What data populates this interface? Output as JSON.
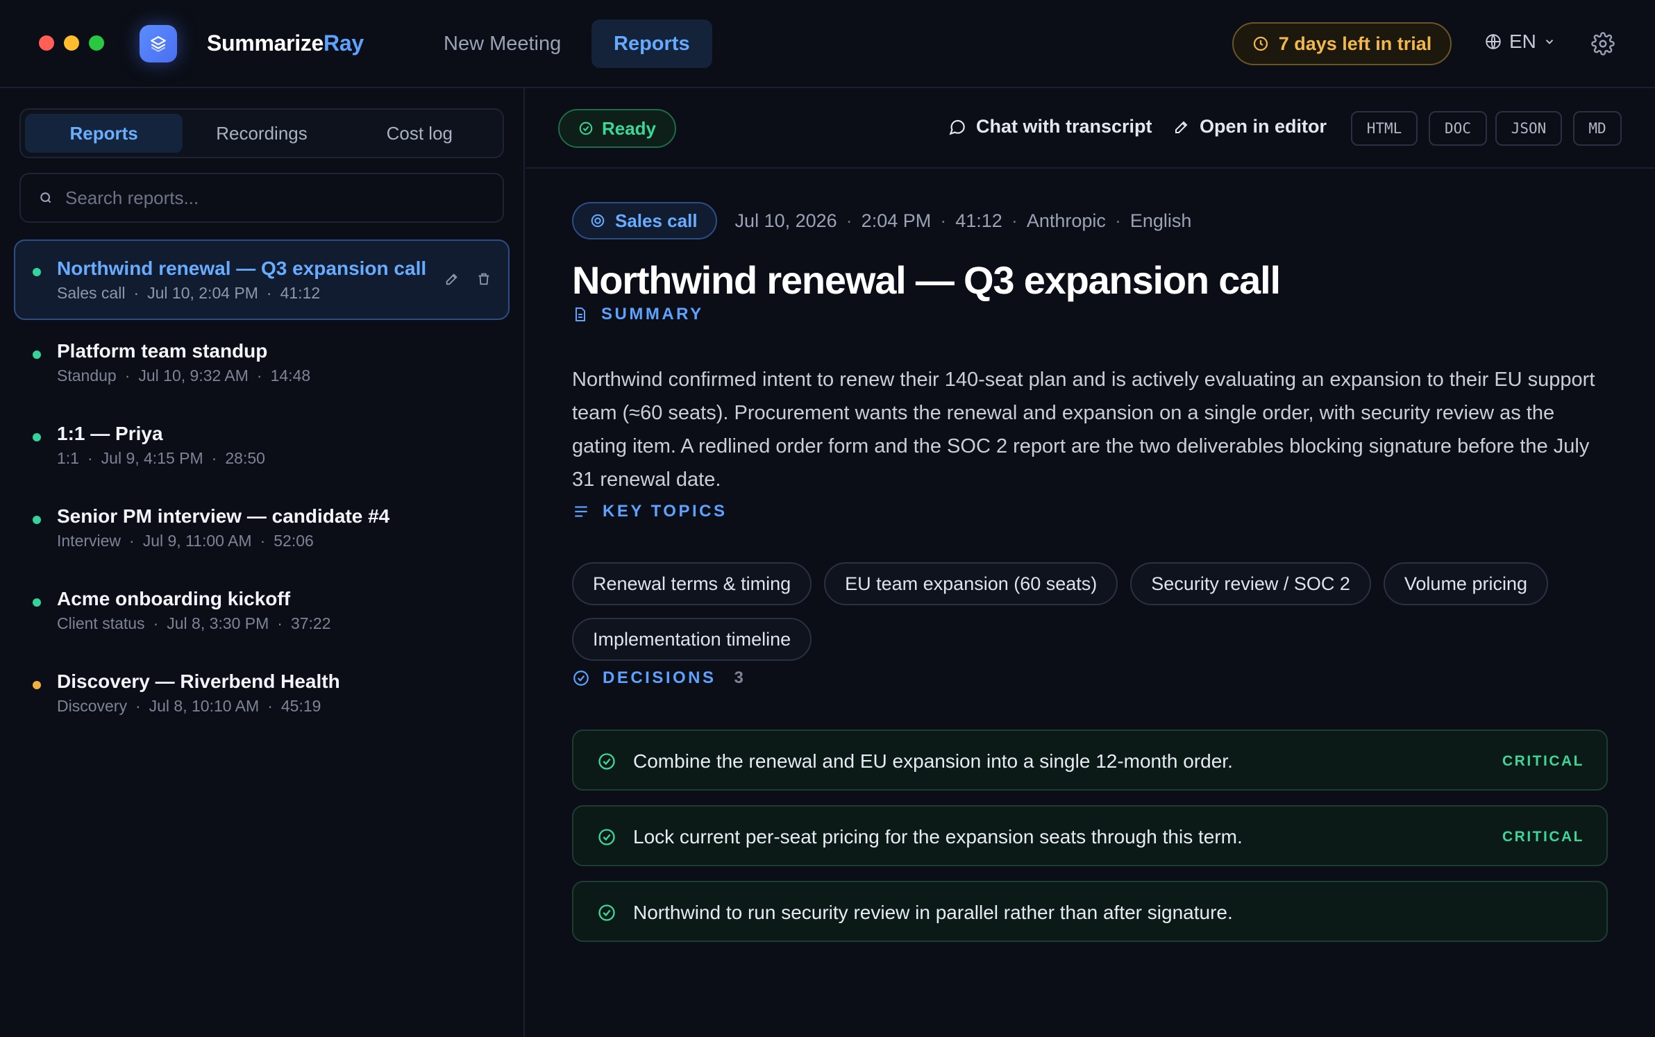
{
  "app": {
    "brand_primary": "Summarize",
    "brand_accent": "Ray",
    "nav": [
      {
        "label": "New Meeting",
        "active": false
      },
      {
        "label": "Reports",
        "active": true
      }
    ],
    "trial_label": "7 days left in trial",
    "language": "EN",
    "colors": {
      "accent": "#5ea2ff",
      "success": "#3ed598",
      "warning": "#f2b84b",
      "background": "#0b0e16"
    }
  },
  "sidebar": {
    "tabs": [
      {
        "label": "Reports",
        "active": true
      },
      {
        "label": "Recordings",
        "active": false
      },
      {
        "label": "Cost log",
        "active": false
      }
    ],
    "search_placeholder": "Search reports...",
    "reports": [
      {
        "title": "Northwind renewal — Q3 expansion call",
        "type": "Sales call",
        "date": "Jul 10, 2:04 PM",
        "duration": "41:12",
        "status_color": "#34d399",
        "active": true
      },
      {
        "title": "Platform team standup",
        "type": "Standup",
        "date": "Jul 10, 9:32 AM",
        "duration": "14:48",
        "status_color": "#34d399",
        "active": false
      },
      {
        "title": "1:1 — Priya",
        "type": "1:1",
        "date": "Jul 9, 4:15 PM",
        "duration": "28:50",
        "status_color": "#34d399",
        "active": false
      },
      {
        "title": "Senior PM interview — candidate #4",
        "type": "Interview",
        "date": "Jul 9, 11:00 AM",
        "duration": "52:06",
        "status_color": "#34d399",
        "active": false
      },
      {
        "title": "Acme onboarding kickoff",
        "type": "Client status",
        "date": "Jul 8, 3:30 PM",
        "duration": "37:22",
        "status_color": "#34d399",
        "active": false
      },
      {
        "title": "Discovery — Riverbend Health",
        "type": "Discovery",
        "date": "Jul 8, 10:10 AM",
        "duration": "45:19",
        "status_color": "#f0b13e",
        "active": false
      }
    ]
  },
  "toolbar": {
    "status": "Ready",
    "chat_label": "Chat with transcript",
    "editor_label": "Open in editor",
    "formats": [
      "HTML",
      "DOC",
      "JSON",
      "MD"
    ]
  },
  "report": {
    "type": "Sales call",
    "date": "Jul 10, 2026",
    "time": "2:04 PM",
    "duration": "41:12",
    "provider": "Anthropic",
    "language": "English",
    "title": "Northwind renewal — Q3 expansion call",
    "summary_heading": "SUMMARY",
    "summary": "Northwind confirmed intent to renew their 140-seat plan and is actively evaluating an expansion to their EU support team (≈60 seats). Procurement wants the renewal and expansion on a single order, with security review as the gating item. A redlined order form and the SOC 2 report are the two deliverables blocking signature before the July 31 renewal date.",
    "topics_heading": "KEY TOPICS",
    "topics": [
      "Renewal terms & timing",
      "EU team expansion (60 seats)",
      "Security review / SOC 2",
      "Volume pricing",
      "Implementation timeline"
    ],
    "decisions_heading": "DECISIONS",
    "decisions_count": "3",
    "decisions": [
      {
        "text": "Combine the renewal and EU expansion into a single 12-month order.",
        "tag": "CRITICAL"
      },
      {
        "text": "Lock current per-seat pricing for the expansion seats through this term.",
        "tag": "CRITICAL"
      },
      {
        "text": "Northwind to run security review in parallel rather than after signature.",
        "tag": ""
      }
    ]
  }
}
